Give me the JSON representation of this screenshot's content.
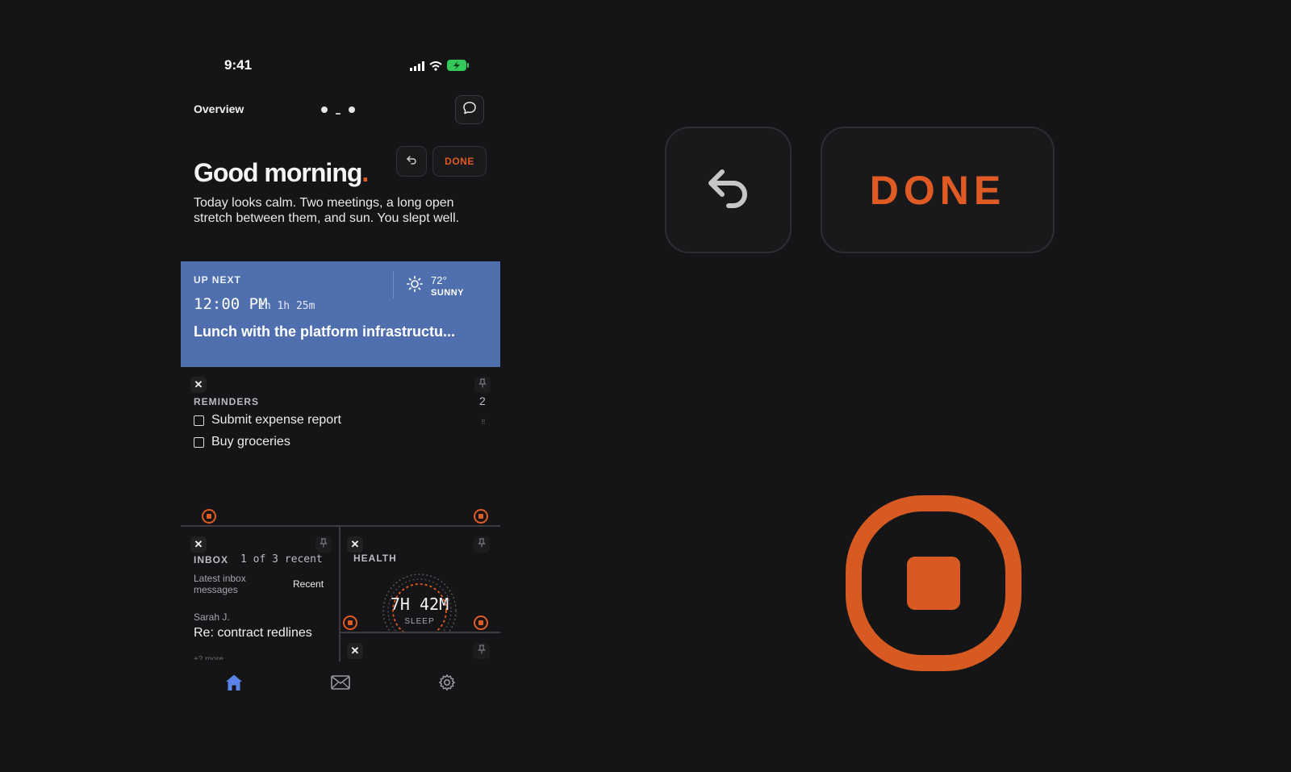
{
  "status_bar": {
    "time": "9:41"
  },
  "header": {
    "title": "Overview"
  },
  "toolbar": {
    "done_label": "DONE"
  },
  "greeting": {
    "title": "Good morning",
    "accent": ".",
    "summary": "Today looks calm. Two meetings, a long open stretch between them, and sun. You slept well."
  },
  "up_next": {
    "label": "UP NEXT",
    "time": "12:00 PM",
    "relative": "in 1h 25m",
    "title": "Lunch with the platform infrastructu...",
    "weather": {
      "temp": "72°",
      "condition": "SUNNY"
    }
  },
  "reminders": {
    "label": "REMINDERS",
    "count": "2",
    "items": [
      "Submit expense report",
      "Buy groceries"
    ]
  },
  "inbox": {
    "label": "INBOX",
    "count_text": "1 of 3 recent",
    "description": "Latest inbox messages",
    "filter": "Recent",
    "sender": "Sarah J.",
    "subject": "Re: contract redlines",
    "more": "+2 more"
  },
  "health": {
    "label": "HEALTH",
    "value": "7H 42M",
    "metric": "SLEEP"
  },
  "zoom": {
    "done_label": "DONE"
  },
  "colors": {
    "accent": "#e05a24",
    "card": "#4f6fae",
    "background": "#151517",
    "tab_active": "#5b84e8"
  }
}
